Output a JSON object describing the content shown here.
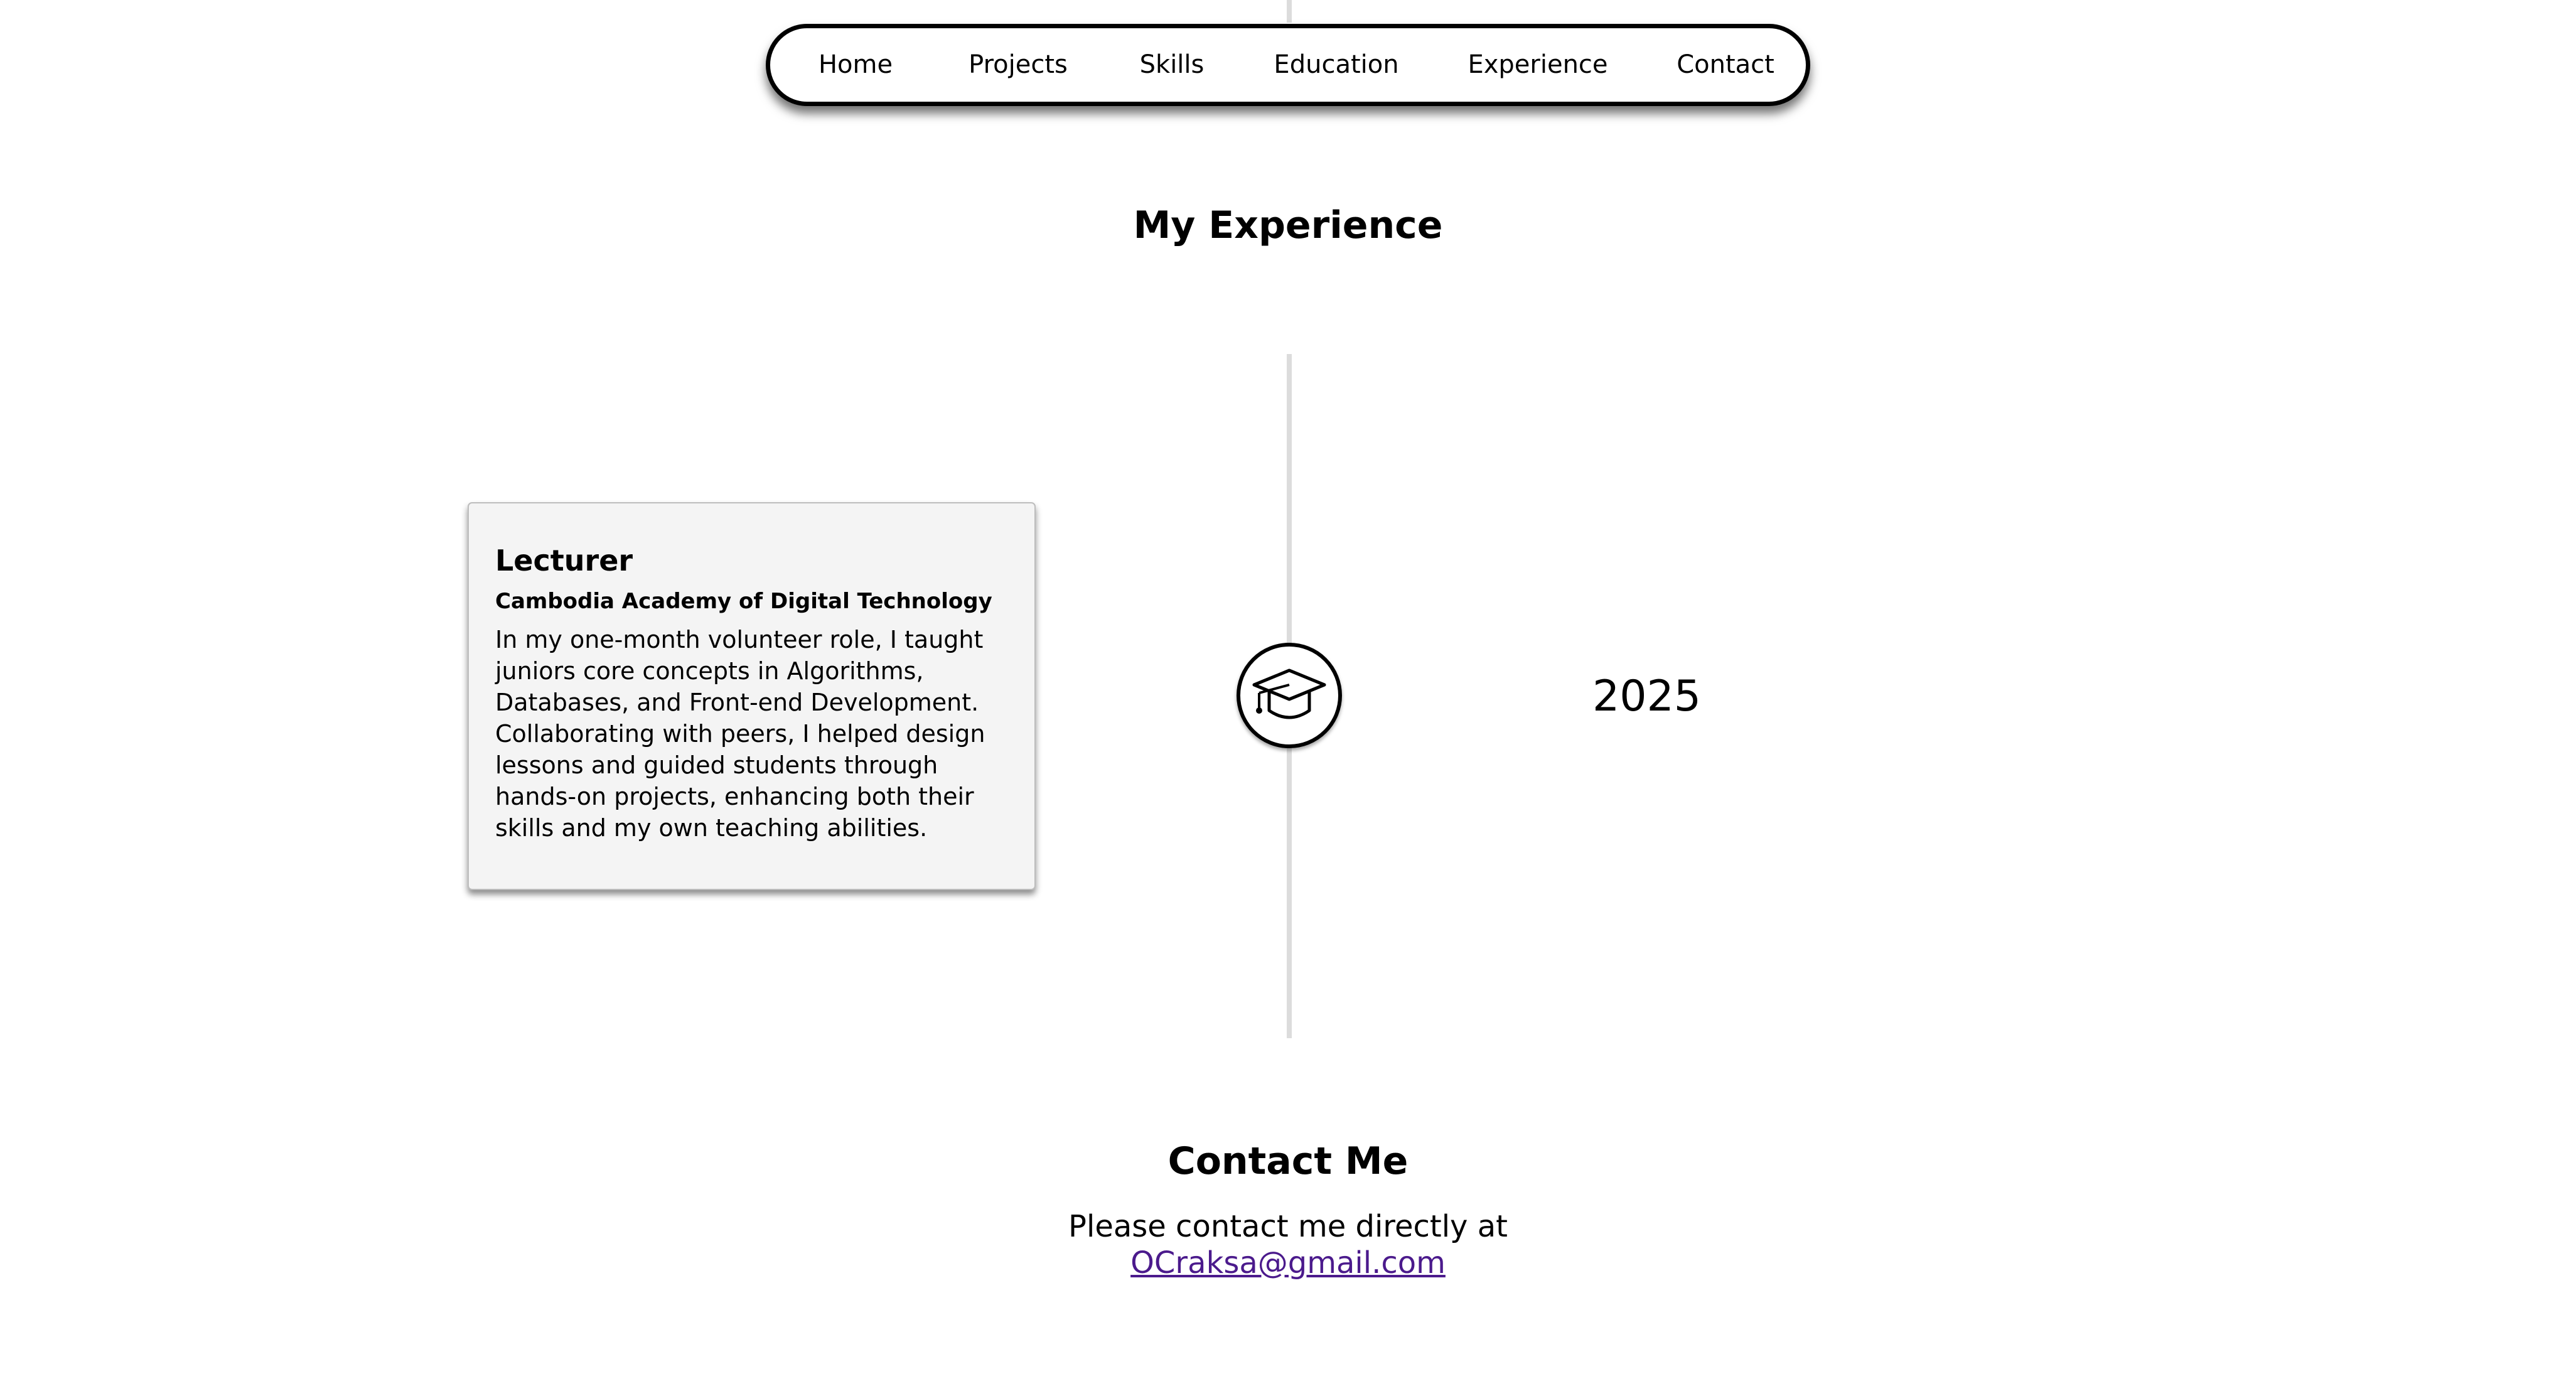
{
  "nav": {
    "items": [
      {
        "label": "Home"
      },
      {
        "label": "Projects"
      },
      {
        "label": "Skills"
      },
      {
        "label": "Education"
      },
      {
        "label": "Experience"
      },
      {
        "label": "Contact"
      }
    ]
  },
  "experience": {
    "title": "My Experience",
    "entries": [
      {
        "role": "Lecturer",
        "organization": "Cambodia Academy of Digital Technology",
        "description": "In my one-month volunteer role, I taught juniors core concepts in Algorithms, Databases, and Front-end Development. Collaborating with peers, I helped design lessons and guided students through hands-on projects, enhancing both their skills and my own teaching abilities.",
        "year": "2025",
        "icon": "graduation-cap-icon"
      }
    ]
  },
  "contact": {
    "title": "Contact Me",
    "text": "Please contact me directly at",
    "email": "OCraksa@gmail.com"
  },
  "colors": {
    "link": "#4b1a8c",
    "card_background": "#f4f4f4",
    "timeline_line": "#dcdcdc",
    "text": "#000000"
  }
}
